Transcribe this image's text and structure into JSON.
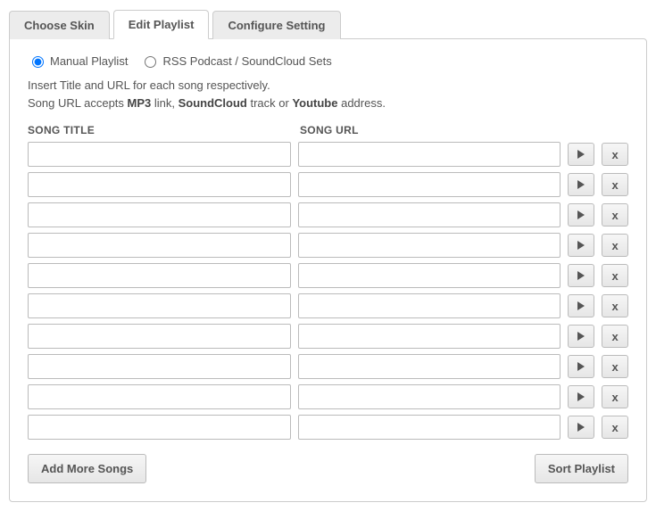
{
  "tabs": {
    "choose_skin": "Choose Skin",
    "edit_playlist": "Edit Playlist",
    "configure_setting": "Configure Setting"
  },
  "radios": {
    "manual": "Manual Playlist",
    "rss": "RSS Podcast / SoundCloud Sets"
  },
  "instructions": {
    "line1": "Insert Title and URL for each song respectively.",
    "line2_prefix": "Song URL accepts ",
    "mp3": "MP3",
    "line2_mid1": " link, ",
    "soundcloud": "SoundCloud",
    "line2_mid2": " track or ",
    "youtube": "Youtube",
    "line2_suffix": " address."
  },
  "headers": {
    "title": "SONG TITLE",
    "url": "SONG URL"
  },
  "row_count": 10,
  "row_delete_label": "x",
  "buttons": {
    "add_more": "Add More Songs",
    "sort": "Sort Playlist"
  }
}
